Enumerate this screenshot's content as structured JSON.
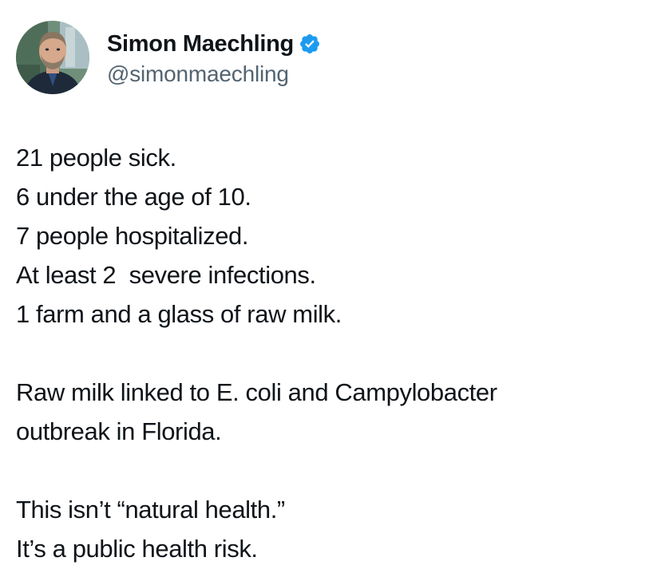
{
  "author": {
    "display_name": "Simon Maechling",
    "handle": "@simonmaechling",
    "verified_icon": "verified-badge-icon",
    "verified_color": "#1d9bf0"
  },
  "tweet": {
    "paragraph_1": [
      "21 people sick.",
      "6 under the age of 10.",
      "7 people hospitalized.",
      "At least 2  severe infections.",
      "1 farm and a glass of raw milk."
    ],
    "paragraph_2": [
      "Raw milk linked to E. coli and Campylobacter",
      "outbreak in Florida."
    ],
    "paragraph_3": [
      "This isn’t “natural health.”",
      "It’s a public health risk."
    ]
  }
}
